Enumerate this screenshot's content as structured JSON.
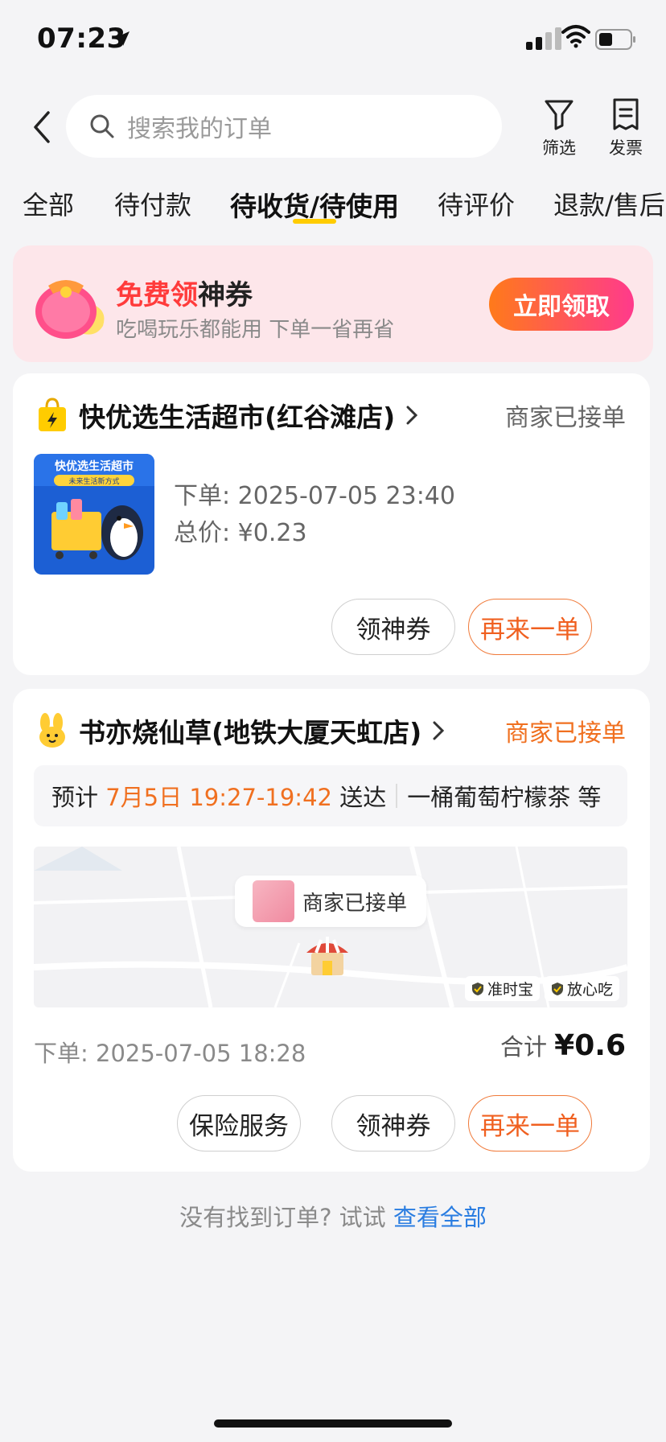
{
  "status_bar": {
    "time": "07:23"
  },
  "header": {
    "search_placeholder": "搜索我的订单",
    "filter_label": "筛选",
    "invoice_label": "发票"
  },
  "tabs": [
    {
      "label": "全部"
    },
    {
      "label": "待付款"
    },
    {
      "label": "待收货/待使用"
    },
    {
      "label": "待评价"
    },
    {
      "label": "退款/售后"
    }
  ],
  "promo": {
    "title_red": "免费领",
    "title_black": "神券",
    "subtitle": "吃喝玩乐都能用 下单一省再省",
    "button": "立即领取"
  },
  "orders": [
    {
      "shop": "快优选生活超市(红谷滩店)",
      "status": "商家已接单",
      "product_image_text": "快优选生活超市",
      "product_image_sub": "未来生活新方式",
      "order_time": "下单: 2025-07-05 23:40",
      "total_price": "总价: ¥0.23",
      "buttons": [
        "领神券",
        "再来一单"
      ]
    },
    {
      "shop": "书亦烧仙草(地铁大厦天虹店)",
      "status": "商家已接单",
      "eta_prefix": "预计",
      "eta_time": "7月5日 19:27-19:42",
      "eta_suffix": "送达",
      "items": "一桶葡萄柠檬茶 等",
      "map_bubble": "商家已接单",
      "badge1": "准时宝",
      "badge2": "放心吃",
      "order_time": "下单: 2025-07-05 18:28",
      "total_label": "合计",
      "total_value": "¥0.6",
      "buttons": [
        "保险服务",
        "领神券",
        "再来一单"
      ]
    }
  ],
  "footer": {
    "hint": "没有找到订单? 试试",
    "link": "查看全部"
  },
  "colors": {
    "accent_yellow": "#ffcc00",
    "accent_orange": "#f07020",
    "link_blue": "#2a7de1",
    "promo_bg": "#fde6ea"
  }
}
